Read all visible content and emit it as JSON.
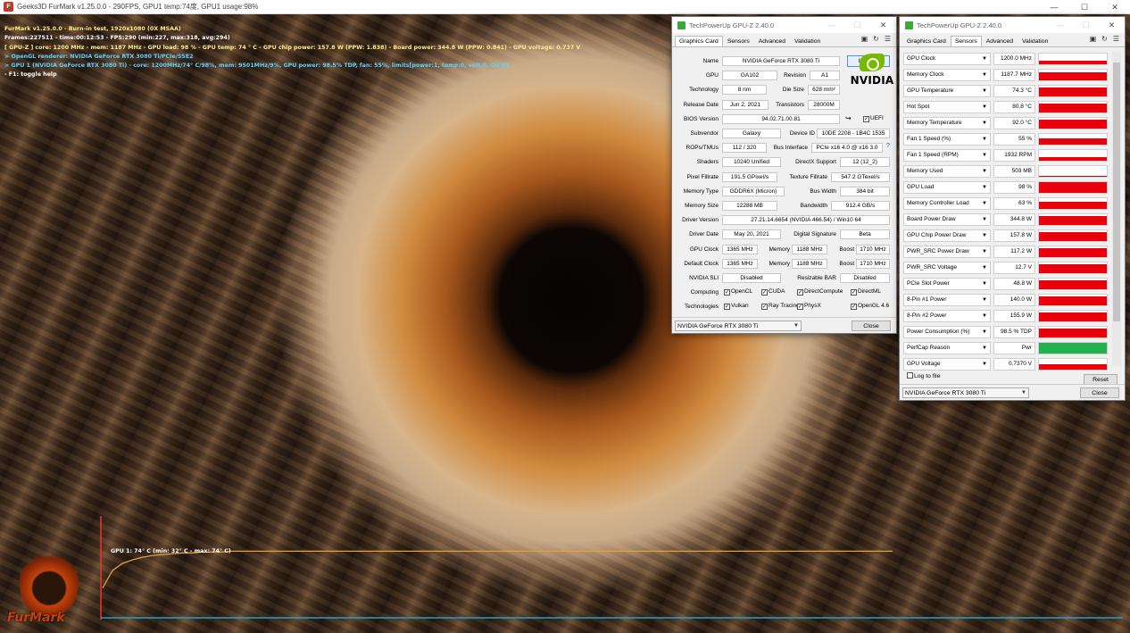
{
  "window": {
    "title": "Geeks3D FurMark v1.25.0.0 - 290FPS, GPU1 temp:74度, GPU1 usage:98%",
    "icon_text": "F"
  },
  "hud": {
    "lines": [
      "FurMark v1.25.0.0 - Burn-in test, 1920x1080 (0X MSAA)",
      "Frames:227511 - time:00:12:53 - FPS:290 (min:227, max:318, avg:294)",
      "[ GPU-Z ] core: 1200 MHz - mem: 1187 MHz - GPU load: 98 % - GPU temp: 74 ° C - GPU chip power: 157.8 W (PPW: 1.838) - Board power: 344.8 W (PPW: 0.841) - GPU voltage: 0.737 V",
      "> OpenGL renderer: NVIDIA GeForce RTX 3080 Ti/PCIe/SSE2",
      "> GPU 1 (NVIDIA GeForce RTX 3080 Ti) - core: 1200MHz/74° C/98%, mem: 9501MHz/9%, GPU power: 98.5% TDP, fan: 55%, limits[power:1, temp:0, volt:0, OV:0]",
      "- F1: toggle help"
    ]
  },
  "temp_graph": {
    "label": "GPU 1: 74° C (min: 32° C - max: 74° C)",
    "series": [
      32,
      52,
      60,
      64,
      67,
      69,
      70,
      71,
      72,
      72,
      73,
      73,
      73,
      74,
      74,
      74,
      74,
      74,
      74,
      74,
      74,
      74,
      74,
      74,
      74,
      74,
      74,
      74,
      74,
      74,
      74,
      74,
      74,
      74,
      74,
      74,
      74,
      74,
      74,
      74,
      74,
      74,
      74,
      74,
      74,
      74,
      74,
      74,
      74,
      74,
      74,
      74,
      74,
      74,
      74,
      74,
      74,
      74,
      74,
      74,
      74,
      74,
      74,
      74,
      74,
      74,
      74,
      74,
      74,
      74,
      74,
      74,
      74,
      74,
      74,
      74,
      74,
      74,
      74,
      74,
      74
    ]
  },
  "logo": {
    "text": "FurMark"
  },
  "gpuz1": {
    "title": "TechPowerUp GPU-Z 2.40.0",
    "tabs": [
      "Graphics Card",
      "Sensors",
      "Advanced",
      "Validation"
    ],
    "labels": {
      "name": "Name",
      "gpu": "GPU",
      "revision": "Revision",
      "technology": "Technology",
      "die_size": "Die Size",
      "release_date": "Release Date",
      "transistors": "Transistors",
      "bios": "BIOS Version",
      "uefi": "UEFI",
      "subvendor": "Subvendor",
      "device_id": "Device ID",
      "rops": "ROPs/TMUs",
      "bus": "Bus Interface",
      "shaders": "Shaders",
      "directx": "DirectX Support",
      "pixel": "Pixel Fillrate",
      "texture": "Texture Fillrate",
      "memtype": "Memory Type",
      "buswidth": "Bus Width",
      "memsize": "Memory Size",
      "bandwidth": "Bandwidth",
      "driver": "Driver Version",
      "driver_date": "Driver Date",
      "digsig": "Digital Signature",
      "gpuclock": "GPU Clock",
      "memory": "Memory",
      "boost": "Boost",
      "defclock": "Default Clock",
      "sli": "NVIDIA SLI",
      "rebar": "Resizable BAR",
      "computing": "Computing",
      "technologies": "Technologies"
    },
    "values": {
      "name": "NVIDIA GeForce RTX 3080 Ti",
      "gpu": "GA102",
      "revision": "A1",
      "technology": "8 nm",
      "die_size": "628 mm²",
      "release_date": "Jun 2, 2021",
      "transistors": "28000M",
      "bios": "94.02.71.00.81",
      "subvendor": "Galaxy",
      "device_id": "10DE 2208 - 1B4C 1535",
      "rops": "112 / 320",
      "bus": "PCIe x16 4.0 @ x16 3.0",
      "shaders": "10240 Unified",
      "directx": "12 (12_2)",
      "pixel": "191.5 GPixel/s",
      "texture": "547.2 GTexel/s",
      "memtype": "GDDR6X (Micron)",
      "buswidth": "384 bit",
      "memsize": "12288 MB",
      "bandwidth": "912.4 GB/s",
      "driver": "27.21.14.6654 (NVIDIA 466.54) / Win10 64",
      "driver_date": "May 20, 2021",
      "digsig": "Beta",
      "gpuclock": "1365 MHz",
      "gpumem": "1188 MHz",
      "gpuboost": "1710 MHz",
      "defclock": "1365 MHz",
      "defmem": "1188 MHz",
      "defboost": "1710 MHz",
      "sli": "Disabled",
      "rebar": "Disabled"
    },
    "computing": [
      "OpenCL",
      "CUDA",
      "DirectCompute",
      "DirectML"
    ],
    "technologies": [
      "Vulkan",
      "Ray Tracing",
      "PhysX",
      "OpenGL 4.6"
    ],
    "lookup": "Lookup",
    "nvidia": "NVIDIA",
    "help": "?",
    "card": "NVIDIA GeForce RTX 3080 Ti",
    "close": "Close"
  },
  "gpuz2": {
    "title": "TechPowerUp GPU-Z 2.40.0",
    "tabs": [
      "Graphics Card",
      "Sensors",
      "Advanced",
      "Validation"
    ],
    "sensors": [
      {
        "name": "GPU Clock",
        "value": "1200.0 MHz",
        "level": 0.3,
        "color": "#e8000b"
      },
      {
        "name": "Memory Clock",
        "value": "1187.7 MHz",
        "level": 0.75,
        "color": "#e8000b"
      },
      {
        "name": "GPU Temperature",
        "value": "74.3 °C",
        "level": 0.8,
        "color": "#e8000b"
      },
      {
        "name": "Hot Spot",
        "value": "80.8 °C",
        "level": 0.8,
        "color": "#e8000b"
      },
      {
        "name": "Memory Temperature",
        "value": "92.0 °C",
        "level": 0.8,
        "color": "#e8000b"
      },
      {
        "name": "Fan 1 Speed (%)",
        "value": "55 %",
        "level": 0.55,
        "color": "#e8000b"
      },
      {
        "name": "Fan 1 Speed (RPM)",
        "value": "1932 RPM",
        "level": 0.3,
        "color": "#e8000b"
      },
      {
        "name": "Memory Used",
        "value": "503 MB",
        "level": 0.05,
        "color": "#e8000b"
      },
      {
        "name": "GPU Load",
        "value": "98 %",
        "level": 0.98,
        "color": "#e8000b"
      },
      {
        "name": "Memory Controller Load",
        "value": "63 %",
        "level": 0.63,
        "color": "#e8000b"
      },
      {
        "name": "Board Power Draw",
        "value": "344.8 W",
        "level": 0.85,
        "color": "#e8000b"
      },
      {
        "name": "GPU Chip Power Draw",
        "value": "157.8 W",
        "level": 0.8,
        "color": "#e8000b"
      },
      {
        "name": "PWR_SRC Power Draw",
        "value": "117.2 W",
        "level": 0.8,
        "color": "#e8000b"
      },
      {
        "name": "PWR_SRC Voltage",
        "value": "12.7 V",
        "level": 0.8,
        "color": "#e8000b"
      },
      {
        "name": "PCIe Slot Power",
        "value": "48.8 W",
        "level": 0.8,
        "color": "#e8000b"
      },
      {
        "name": "8-Pin #1 Power",
        "value": "140.0 W",
        "level": 0.8,
        "color": "#e8000b"
      },
      {
        "name": "8-Pin #2 Power",
        "value": "155.9 W",
        "level": 0.8,
        "color": "#e8000b"
      },
      {
        "name": "Power Consumption (%)",
        "value": "98.5 % TDP",
        "level": 0.8,
        "color": "#e8000b"
      },
      {
        "name": "PerfCap Reason",
        "value": "Pwr",
        "level": 1.0,
        "color": "#22b14c"
      },
      {
        "name": "GPU Voltage",
        "value": "0.7370 V",
        "level": 0.5,
        "color": "#e8000b"
      }
    ],
    "log": "Log to file",
    "reset": "Reset",
    "card": "NVIDIA GeForce RTX 3080 Ti",
    "close": "Close"
  }
}
